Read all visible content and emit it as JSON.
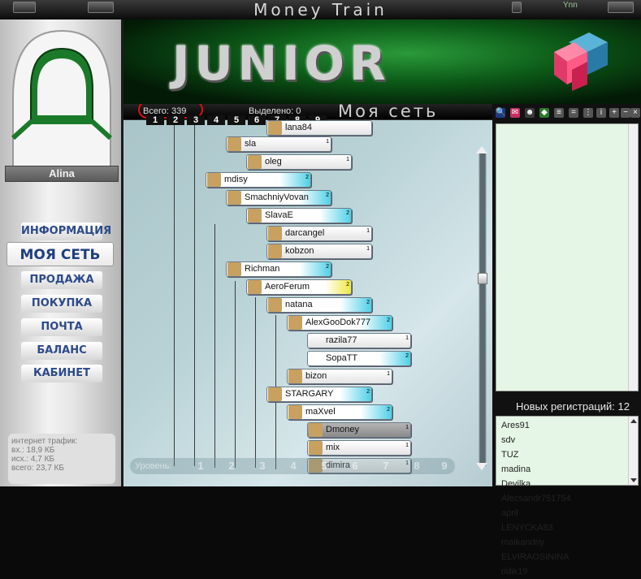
{
  "window": {
    "title": "Money Train",
    "user_glyph": "Ynn"
  },
  "sidebar": {
    "username": "Alina",
    "menu": [
      {
        "label": "ИНФОРМАЦИЯ"
      },
      {
        "label": "МОЯ СЕТЬ"
      },
      {
        "label": "ПРОДАЖА"
      },
      {
        "label": "ПОКУПКА"
      },
      {
        "label": "ПОЧТА"
      },
      {
        "label": "БАЛАНС"
      },
      {
        "label": "КАБИНЕТ"
      }
    ],
    "traffic": {
      "title": "интернет трафик:",
      "in": "вх.: 18,9 КБ",
      "out": "исх.: 4,7 КБ",
      "total": "всего: 23,7 КБ"
    }
  },
  "banner": {
    "text": "JUNIOR"
  },
  "tree": {
    "total": "Всего: 339",
    "selected": "Выделено: 0",
    "section_title": "Моя сеть",
    "levels": [
      "1",
      "2",
      "3",
      "4",
      "5",
      "6",
      "7",
      "8",
      "9"
    ],
    "level_label": "Уровень:",
    "nodes": [
      {
        "name": "lana84",
        "count": ""
      },
      {
        "name": "sla",
        "count": "1"
      },
      {
        "name": "oleg",
        "count": "1"
      },
      {
        "name": "mdisy",
        "count": "2"
      },
      {
        "name": "SmachniyVovan",
        "count": "2"
      },
      {
        "name": "SlavaE",
        "count": "2"
      },
      {
        "name": "darcangel",
        "count": "1"
      },
      {
        "name": "kobzon",
        "count": "1"
      },
      {
        "name": "Richman",
        "count": "2"
      },
      {
        "name": "AeroFerum",
        "count": "2"
      },
      {
        "name": "natana",
        "count": "2"
      },
      {
        "name": "AlexGooDok777",
        "count": "2"
      },
      {
        "name": "razila77",
        "count": "1"
      },
      {
        "name": "SopaTT",
        "count": "2"
      },
      {
        "name": "bizon",
        "count": "1"
      },
      {
        "name": "STARGARY",
        "count": "2"
      },
      {
        "name": "maXvel",
        "count": "2"
      },
      {
        "name": "Dmoney",
        "count": "1"
      },
      {
        "name": "mix",
        "count": "1"
      },
      {
        "name": "dimira",
        "count": "1"
      }
    ]
  },
  "right_panel": {
    "new_reg_title": "Новых регистраций: 12",
    "registrations": [
      "Ares91",
      "sdv",
      "TUZ",
      "madina",
      "Devilka",
      "Alecsandr751754",
      "april",
      "LENYCKA83",
      "maikandriy",
      "ELVIRAOSININA",
      "ridik19"
    ]
  },
  "colors": {
    "accent_green": "#0c5a18",
    "highlight_red": "#e01010",
    "menu_blue": "#2d4a8a"
  }
}
